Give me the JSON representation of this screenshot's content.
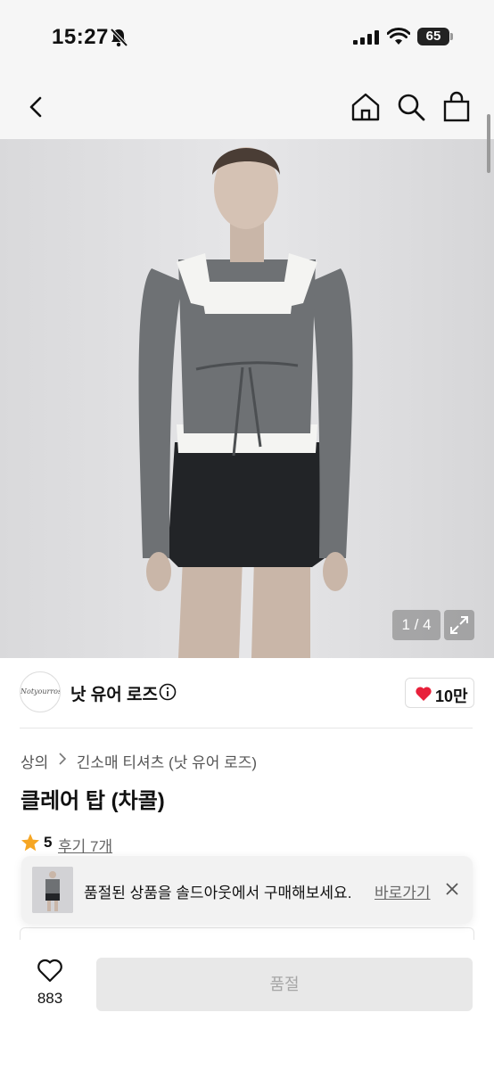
{
  "status_bar": {
    "time": "15:27",
    "battery": "65"
  },
  "nav": {
    "back_icon": "chevron-left-icon",
    "home_icon": "home-icon",
    "search_icon": "search-icon",
    "bag_icon": "shopping-bag-icon"
  },
  "gallery": {
    "counter": "1 / 4",
    "expand_icon": "expand-icon",
    "colors": {
      "top": "#6e7174",
      "shirt": "#f4f4f2",
      "skirt": "#222427",
      "background": "#dfdfe1"
    }
  },
  "shop": {
    "name": "낫 유어 로즈",
    "avatar_text": "Notyourrose",
    "likes": "10만",
    "heart_color": "#e8203a"
  },
  "breadcrumb": {
    "category": "상의",
    "subcategory": "긴소매 티셔츠 (낫 유어 로즈)"
  },
  "product": {
    "title": "클레어 탑 (차콜)",
    "rating": "5",
    "reviews": "후기 7개",
    "star_color": "#f6a623"
  },
  "toast": {
    "message": "품절된 상품을 솔드아웃에서 구매해보세요.",
    "link": "바로가기"
  },
  "bottom_bar": {
    "wish_count": "883",
    "buy_button": "품절"
  }
}
